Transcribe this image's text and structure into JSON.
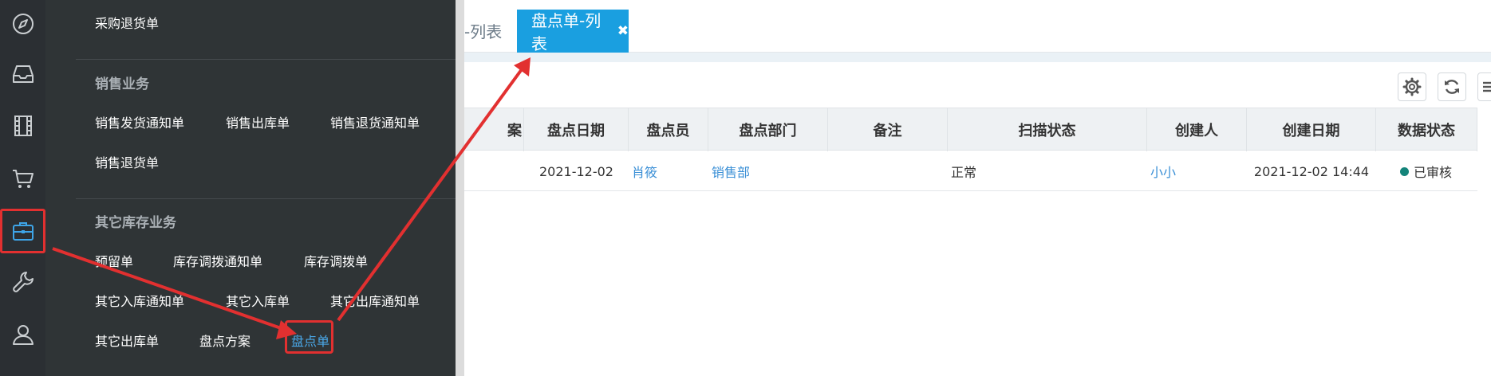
{
  "tabs": {
    "prev_label": "-列表",
    "active_label": "盘点单-列表",
    "close_symbol": "✖"
  },
  "grid": {
    "headers": [
      "盘点日期",
      "盘点员",
      "盘点部门",
      "备注",
      "扫描状态",
      "创建人",
      "创建日期",
      "数据状态"
    ],
    "cut_header": "案",
    "row": {
      "date": "2021-12-02",
      "clerk": "肖筱",
      "dept": "销售部",
      "remark": "",
      "scan_status": "正常",
      "creator": "小小",
      "created": "2021-12-02 14:44",
      "status": "已审核"
    },
    "status_color": "#14847a"
  },
  "menu": {
    "top_item": "采购退货单",
    "sections": [
      {
        "title": "销售业务",
        "items": [
          "销售发货通知单",
          "销售出库单",
          "销售退货通知单",
          "销售退货单"
        ]
      },
      {
        "title": "其它库存业务",
        "items": [
          "预留单",
          "库存调拨通知单",
          "库存调拨单",
          "其它入库通知单",
          "其它入库单",
          "其它出库通知单",
          "其它出库单",
          "盘点方案",
          "盘点单"
        ]
      }
    ],
    "active_item": "盘点单"
  },
  "sidebar_icons": [
    "compass-icon",
    "inbox-icon",
    "film-icon",
    "cart-icon",
    "briefcase-icon",
    "wrench-icon",
    "user-icon"
  ],
  "colors": {
    "accent": "#1a9fe0",
    "annotation": "#e23030",
    "sidebar": "#2b2f33",
    "menu": "#2f3436"
  }
}
